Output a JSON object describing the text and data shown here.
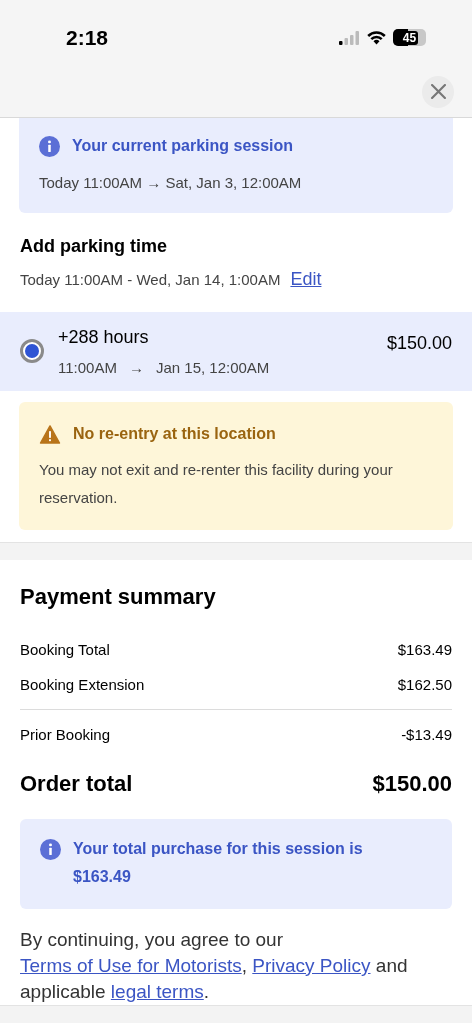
{
  "status_bar": {
    "time": "2:18",
    "battery": "45"
  },
  "current_session": {
    "title": "Your current parking session",
    "range": "Today 11:00AM → Sat, Jan 3, 12:00AM"
  },
  "add_time": {
    "title": "Add parking time",
    "range": "Today 11:00AM - Wed, Jan 14, 1:00AM",
    "edit_link": "Edit"
  },
  "options": [
    {
      "label": "+288 hours",
      "start": "11:00AM",
      "arrow": "→",
      "end": "Jan 15, 12:00AM",
      "price": "$150.00",
      "selected": true
    }
  ],
  "warning": {
    "title": "No re-entry at this location",
    "text": "You may not exit and re-renter this facility during your reservation."
  },
  "payment_summary": {
    "title": "Payment summary",
    "line_groups": [
      [
        {
          "label": "Booking Total",
          "amount": "$163.49"
        },
        {
          "label": "Booking Extension",
          "amount": "$162.50"
        }
      ],
      [
        {
          "label": "Prior Booking",
          "amount": "-$13.49"
        }
      ]
    ],
    "total": {
      "label": "Order total",
      "amount": "$150.00"
    },
    "notice": "Your total purchase for this session is $163.49"
  },
  "legal": [
    {
      "kind": "text",
      "text": "By continuing, you agree to our "
    },
    {
      "kind": "link",
      "text": "Terms of Use for Motorists"
    },
    {
      "kind": "text",
      "text": ", "
    },
    {
      "kind": "link",
      "text": "Privacy Policy"
    },
    {
      "kind": "text",
      "text": " and applicable "
    },
    {
      "kind": "link",
      "text": "legal terms"
    },
    {
      "kind": "text",
      "text": "."
    }
  ]
}
